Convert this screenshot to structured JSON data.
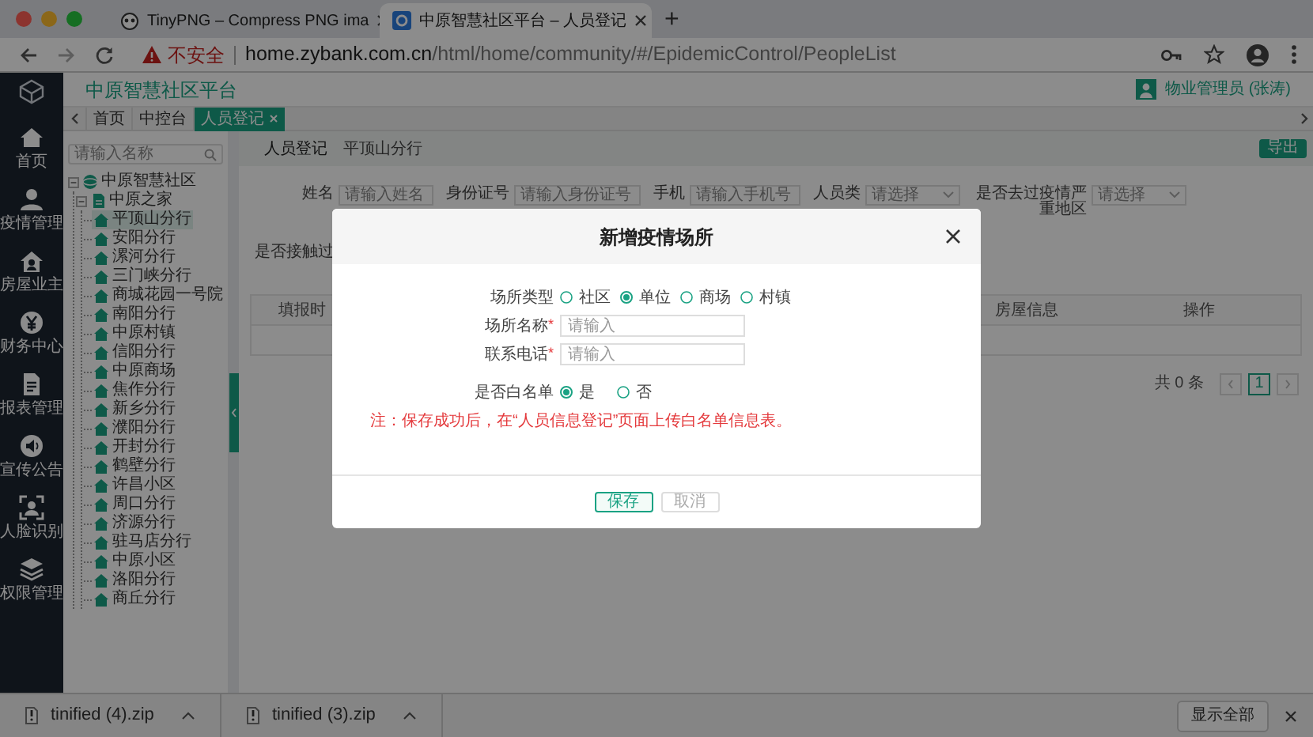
{
  "browser": {
    "tabs": [
      {
        "title": "TinyPNG – Compress PNG ima",
        "selected": false
      },
      {
        "title": "中原智慧社区平台 – 人员登记",
        "selected": true
      }
    ],
    "new_tab": "+",
    "security_warning": "不安全",
    "url_host": "home.zybank.com.cn",
    "url_path": "/html/home/community/#/EpidemicControl/PeopleList"
  },
  "header": {
    "title": "中原智慧社区平台",
    "user": "物业管理员 (张涛)"
  },
  "nav": [
    {
      "kind": "home",
      "label": "首页"
    },
    {
      "kind": "person",
      "label": "疫情管理"
    },
    {
      "kind": "house",
      "label": "房屋业主"
    },
    {
      "kind": "coin",
      "label": "财务中心"
    },
    {
      "kind": "document",
      "label": "报表管理"
    },
    {
      "kind": "speaker",
      "label": "宣传公告"
    },
    {
      "kind": "face",
      "label": "人脸识别"
    },
    {
      "kind": "layers",
      "label": "权限管理"
    }
  ],
  "breadcrumbs": [
    {
      "label": "首页",
      "selected": false
    },
    {
      "label": "中控台",
      "selected": false
    },
    {
      "label": "人员登记",
      "selected": true
    }
  ],
  "tree": {
    "search_placeholder": "请输入名称",
    "items": [
      {
        "label": "中原智慧社区",
        "expanded": true,
        "selected": false,
        "children": [
          {
            "label": "中原之家",
            "expanded": true,
            "selected": false,
            "children": [
              {
                "label": "平顶山分行",
                "selected": true
              },
              {
                "label": "安阳分行",
                "selected": false
              },
              {
                "label": "漯河分行",
                "selected": false
              },
              {
                "label": "三门峡分行",
                "selected": false
              },
              {
                "label": "商城花园一号院",
                "selected": false
              },
              {
                "label": "南阳分行",
                "selected": false
              },
              {
                "label": "中原村镇",
                "selected": false
              },
              {
                "label": "信阳分行",
                "selected": false
              },
              {
                "label": "中原商场",
                "selected": false
              },
              {
                "label": "焦作分行",
                "selected": false
              },
              {
                "label": "新乡分行",
                "selected": false
              },
              {
                "label": "濮阳分行",
                "selected": false
              },
              {
                "label": "开封分行",
                "selected": false
              },
              {
                "label": "鹤壁分行",
                "selected": false
              },
              {
                "label": "许昌小区",
                "selected": false
              },
              {
                "label": "周口分行",
                "selected": false
              },
              {
                "label": "济源分行",
                "selected": false
              },
              {
                "label": "驻马店分行",
                "selected": false
              },
              {
                "label": "中原小区",
                "selected": false
              },
              {
                "label": "洛阳分行",
                "selected": false
              },
              {
                "label": "商丘分行",
                "selected": false
              }
            ]
          }
        ]
      }
    ]
  },
  "page": {
    "title": "人员登记",
    "branch": "平顶山分行",
    "export_button": "导出",
    "filters": [
      {
        "kind": "input",
        "label": "姓名",
        "placeholder": "请输入姓名"
      },
      {
        "kind": "input",
        "label": "身份证号",
        "placeholder": "请输入身份证号"
      },
      {
        "kind": "input",
        "label": "手机",
        "placeholder": "请输入手机号"
      },
      {
        "kind": "select",
        "label": "人员类",
        "placeholder": "请选择"
      },
      {
        "kind": "select",
        "label": "是否去过疫情严重地区",
        "placeholder": "请选择"
      }
    ],
    "filter_row_2_label": "是否接触过",
    "table": {
      "columns": [
        "填报时",
        "房屋信息",
        "操作"
      ]
    },
    "pagination": {
      "total": "共 0 条",
      "current_page": "1"
    }
  },
  "dialog": {
    "title": "新增疫情场所",
    "place_type": {
      "label": "场所类型",
      "options": [
        {
          "label": "社区",
          "selected": false
        },
        {
          "label": "单位",
          "selected": true
        },
        {
          "label": "商场",
          "selected": false
        },
        {
          "label": "村镇",
          "selected": false
        }
      ]
    },
    "fields": [
      {
        "label": "场所名称",
        "required_mark": "*",
        "placeholder": "请输入"
      },
      {
        "label": "联系电话",
        "required_mark": "*",
        "placeholder": "请输入"
      }
    ],
    "whitelist": {
      "label": "是否白名单",
      "options": [
        {
          "label": "是",
          "selected": true
        },
        {
          "label": "否",
          "selected": false
        }
      ]
    },
    "note": "注：保存成功后，在“人员信息登记”页面上传白名单信息表。",
    "buttons": [
      {
        "label": "保存",
        "disabled": false
      },
      {
        "label": "取消",
        "disabled": true
      }
    ]
  },
  "downloads": {
    "files": [
      "tinified (4).zip",
      "tinified (3).zip"
    ],
    "show_all": "显示全部"
  }
}
